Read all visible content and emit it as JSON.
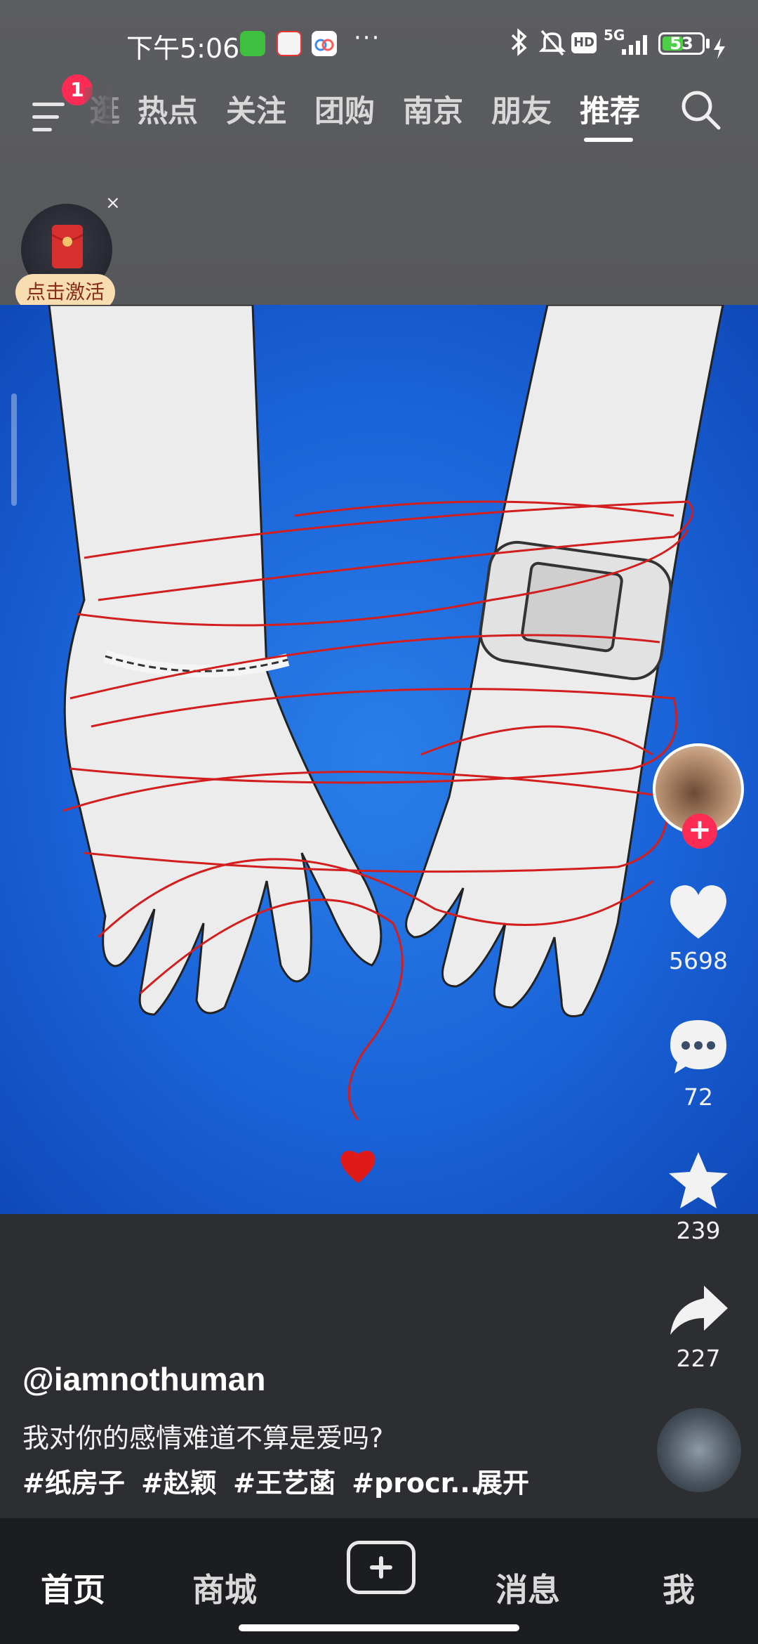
{
  "status_bar": {
    "time": "下午5:06",
    "network": "5G",
    "hd": "HD",
    "battery": "53",
    "battery_level": 0.53,
    "more": "···"
  },
  "nav": {
    "badge": "1",
    "partial_tab": "逛",
    "tabs": [
      "热点",
      "关注",
      "团购",
      "南京",
      "朋友",
      "推荐"
    ],
    "active_tab": "推荐"
  },
  "red_packet": {
    "label": "点击激活",
    "close": "×"
  },
  "actions": {
    "likes": "5698",
    "comments": "72",
    "favorites": "239",
    "shares": "227"
  },
  "caption": {
    "author": "@iamnothuman",
    "description": "我对你的感情难道不算是爱吗?",
    "tags": [
      "#纸房子",
      "#赵颖",
      "#王艺菡",
      "#procr..."
    ],
    "expand": "展开"
  },
  "bottom_nav": {
    "items": [
      "首页",
      "商城",
      "消息",
      "我"
    ],
    "active": "首页"
  },
  "colors": {
    "accent": "#fe2c55",
    "art_background": "#1a63d9",
    "thread": "#d21e1e"
  }
}
